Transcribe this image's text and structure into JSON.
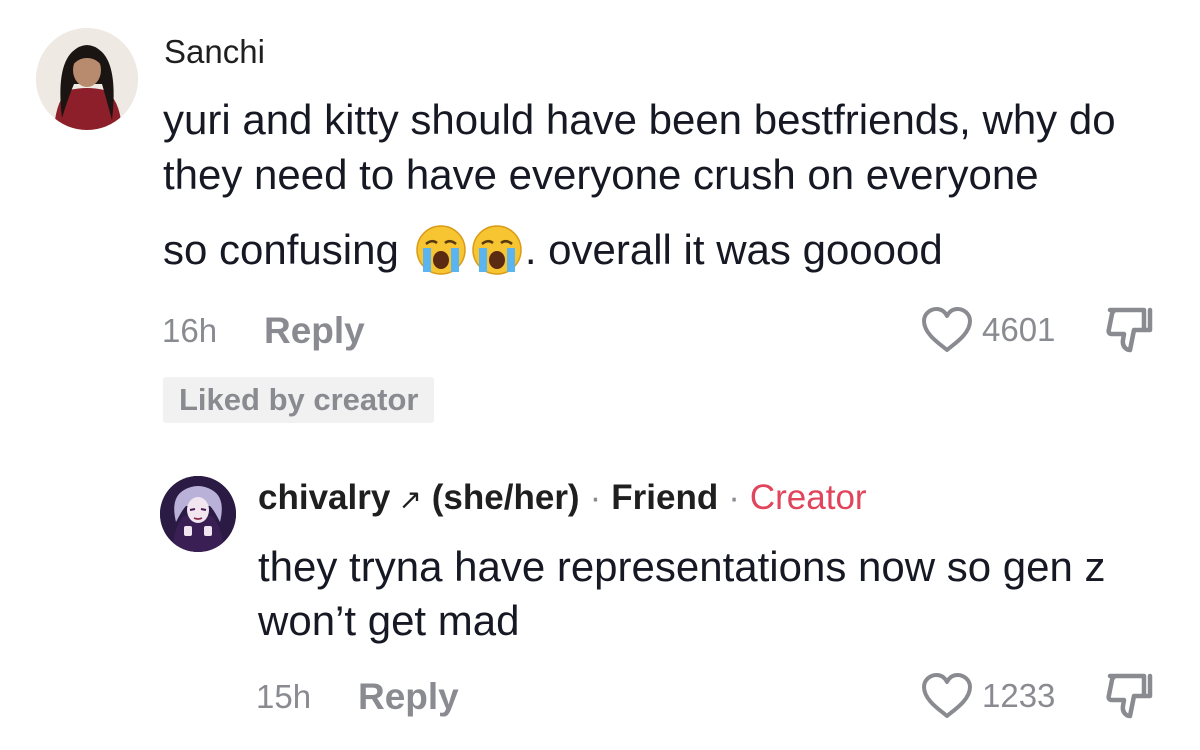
{
  "comment": {
    "username": "Sanchi",
    "text_lines": [
      "yuri and kitty should have been bestfriends, why do they need to have everyone crush on everyone"
    ],
    "text_line3_prefix": "so confusing",
    "text_line3_suffix": ". overall it was gooood",
    "emoji": "crying-face-emoji",
    "timestamp": "16h",
    "reply_label": "Reply",
    "like_count": "4601",
    "liked_by_creator": "Liked by creator"
  },
  "reply": {
    "username": "chivalry",
    "arrow": "↗",
    "pronouns": "(she/her)",
    "separator": "·",
    "friend_tag": "Friend",
    "creator_tag": "Creator",
    "text": "they tryna have representations now so gen z won’t get mad",
    "timestamp": "15h",
    "reply_label": "Reply",
    "like_count": "1233"
  },
  "colors": {
    "text": "#161823",
    "muted": "#8a8b91",
    "creator": "#e0455c",
    "badge_bg": "#f1f1f2"
  }
}
